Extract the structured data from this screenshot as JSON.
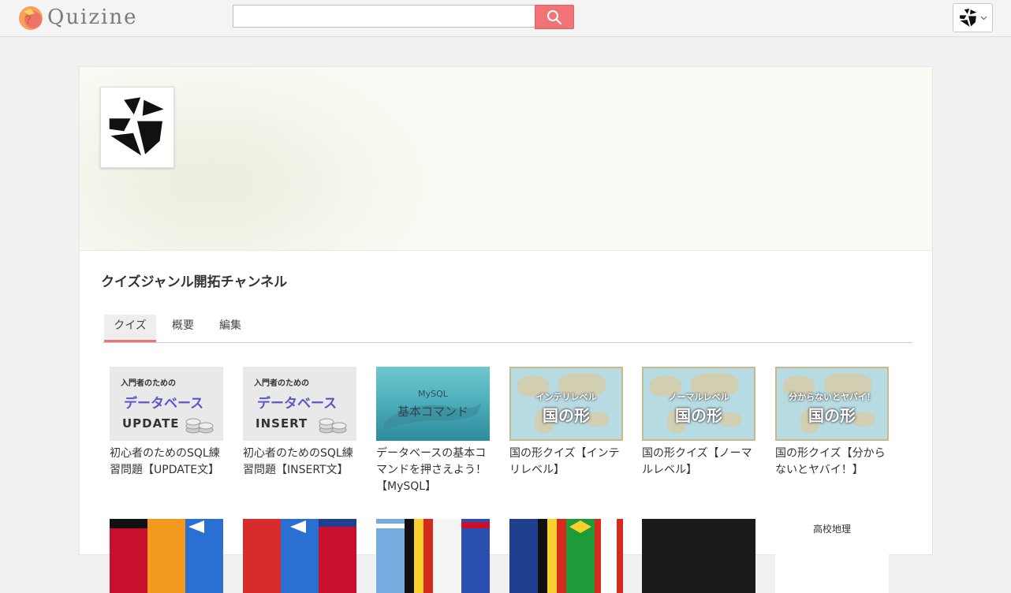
{
  "app": {
    "name": "Quizine"
  },
  "search": {
    "placeholder": "",
    "value": ""
  },
  "channel": {
    "name": "クイズジャンル開拓チャンネル"
  },
  "tabs": [
    {
      "label": "クイズ",
      "active": true
    },
    {
      "label": "概要",
      "active": false
    },
    {
      "label": "編集",
      "active": false
    }
  ],
  "quizzes": [
    {
      "title": "初心者のためのSQL練習問題【UPDATE文】",
      "thumb": {
        "line1": "入門者のための",
        "line2": "データベース",
        "line3": "UPDATE"
      }
    },
    {
      "title": "初心者のためのSQL練習問題【INSERT文】",
      "thumb": {
        "line1": "入門者のための",
        "line2": "データベース",
        "line3": "INSERT"
      }
    },
    {
      "title": "データベースの基本コマンドを押さえよう！【MySQL】",
      "thumb": {
        "line1": "MySQL",
        "line2": "基本コマンド"
      }
    },
    {
      "title": "国の形クイズ【インテリレベル】",
      "thumb": {
        "line1": "インテリレベル",
        "line2": "国の形"
      }
    },
    {
      "title": "国の形クイズ【ノーマルレベル】",
      "thumb": {
        "line1": "ノーマルレベル",
        "line2": "国の形"
      }
    },
    {
      "title": "国の形クイズ【分からないとヤバイ！】",
      "thumb": {
        "line1": "分からないとヤバイ！",
        "line2": "国の形"
      }
    }
  ],
  "quizzes_row2": [
    {
      "thumb_kind": "flags"
    },
    {
      "thumb_kind": "flags"
    },
    {
      "thumb_kind": "flags"
    },
    {
      "thumb_kind": "flags"
    },
    {
      "thumb_kind": "dark"
    },
    {
      "thumb_kind": "text",
      "thumb": {
        "line1": "高校地理"
      }
    }
  ],
  "colors": {
    "accent": "#f07475",
    "background": "#f1f1f1",
    "db_title": "#5a57c9"
  },
  "icons": {
    "search": "search-icon",
    "user": "user-avatar-icon",
    "dropdown": "chevron-down-icon"
  }
}
